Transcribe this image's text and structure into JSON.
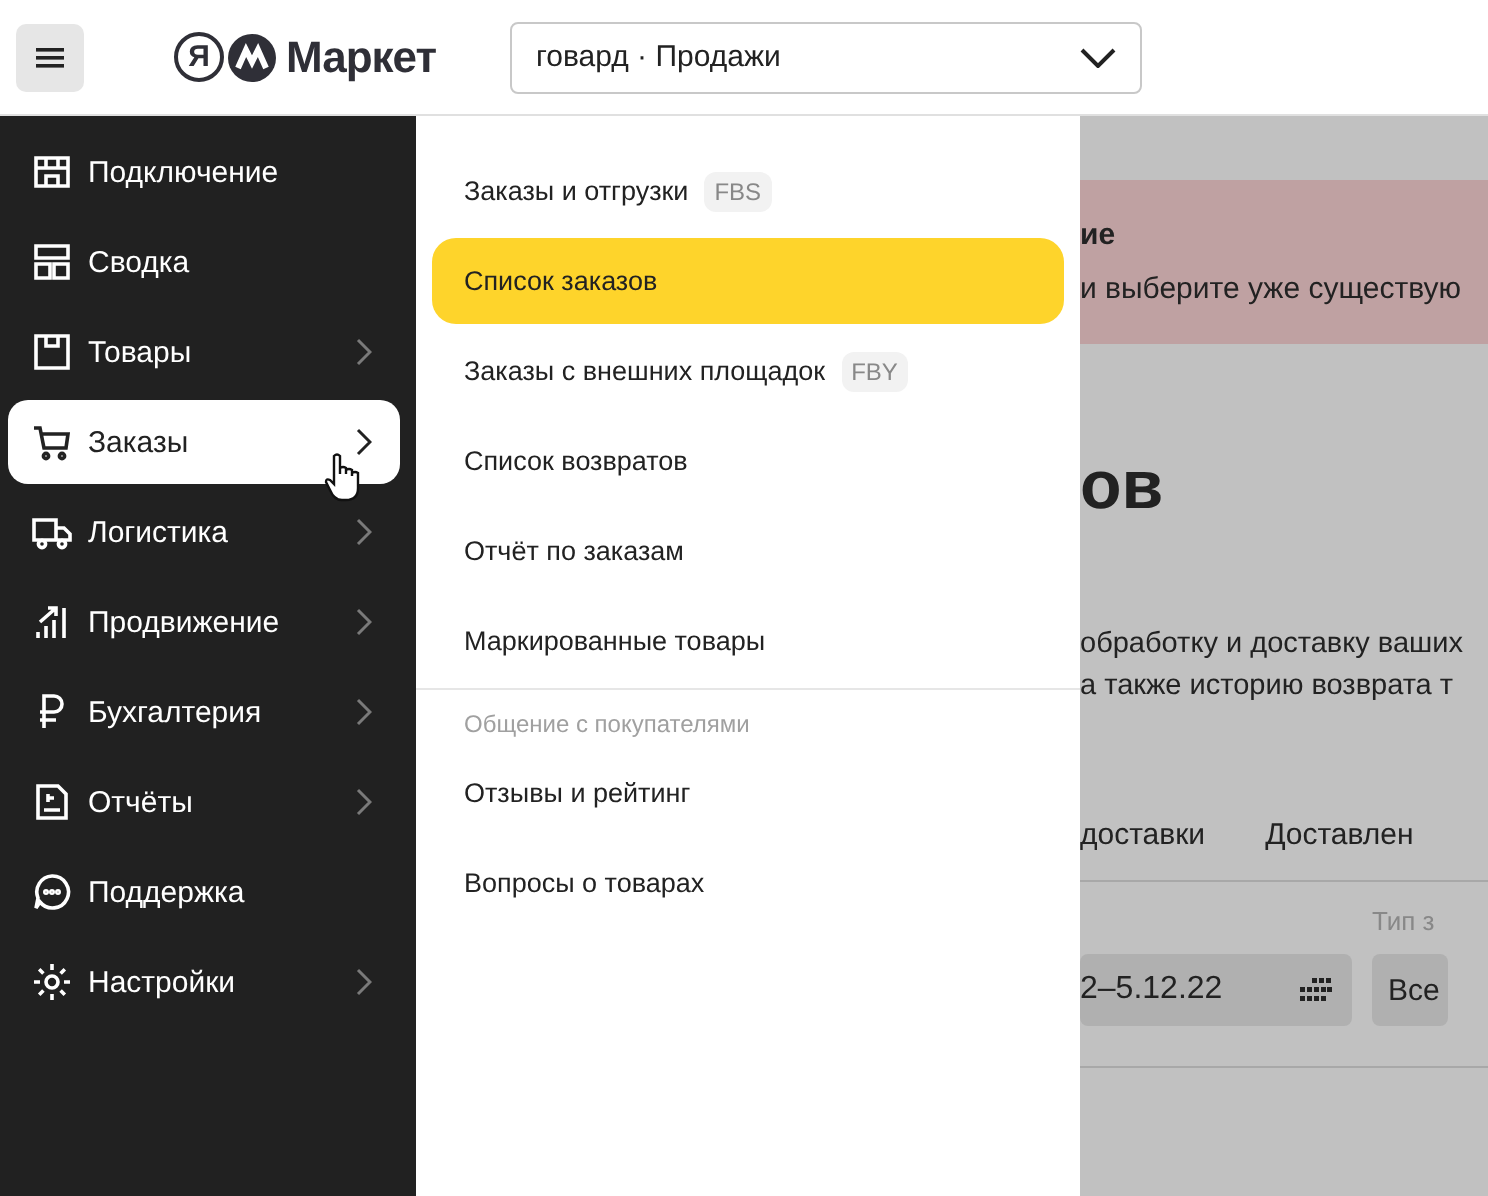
{
  "header": {
    "logo_mark": "Я",
    "logo_name": "Маркет",
    "account_select": {
      "value": "говард · Продажи"
    }
  },
  "sidebar": {
    "items": [
      {
        "label": "Подключение",
        "chevron": false,
        "selected": false
      },
      {
        "label": "Сводка",
        "chevron": false,
        "selected": false
      },
      {
        "label": "Товары",
        "chevron": true,
        "selected": false
      },
      {
        "label": "Заказы",
        "chevron": true,
        "selected": true
      },
      {
        "label": "Логистика",
        "chevron": true,
        "selected": false
      },
      {
        "label": "Продвижение",
        "chevron": true,
        "selected": false
      },
      {
        "label": "Бухгалтерия",
        "chevron": true,
        "selected": false
      },
      {
        "label": "Отчёты",
        "chevron": true,
        "selected": false
      },
      {
        "label": "Поддержка",
        "chevron": false,
        "selected": false
      },
      {
        "label": "Настройки",
        "chevron": true,
        "selected": false
      }
    ]
  },
  "submenu": {
    "items": [
      {
        "kind": "link",
        "label": "Заказы и отгрузки",
        "badge": "FBS",
        "selected": false
      },
      {
        "kind": "link",
        "label": "Список заказов",
        "selected": true
      },
      {
        "kind": "link",
        "label": "Заказы с внешних площадок",
        "badge": "FBY",
        "selected": false
      },
      {
        "kind": "link",
        "label": "Список возвратов",
        "selected": false
      },
      {
        "kind": "link",
        "label": "Отчёт по заказам",
        "selected": false
      },
      {
        "kind": "link",
        "label": "Маркированные товары",
        "selected": false
      },
      {
        "kind": "section",
        "label": "Общение с покупателями"
      },
      {
        "kind": "link",
        "label": "Отзывы и рейтинг",
        "selected": false
      },
      {
        "kind": "link",
        "label": "Вопросы о товарах",
        "selected": false
      }
    ]
  },
  "background_page": {
    "banner": {
      "title": "ие",
      "text": "и выберите уже существую"
    },
    "heading": "ов",
    "description": [
      "обработку и доставку ваших",
      "а также историю возврата т"
    ],
    "tabs": [
      "доставки",
      "Доставлен"
    ],
    "type_label": "Тип з",
    "date_field": {
      "value": "2–5.12.22"
    },
    "type_select": {
      "value": "Все"
    }
  }
}
